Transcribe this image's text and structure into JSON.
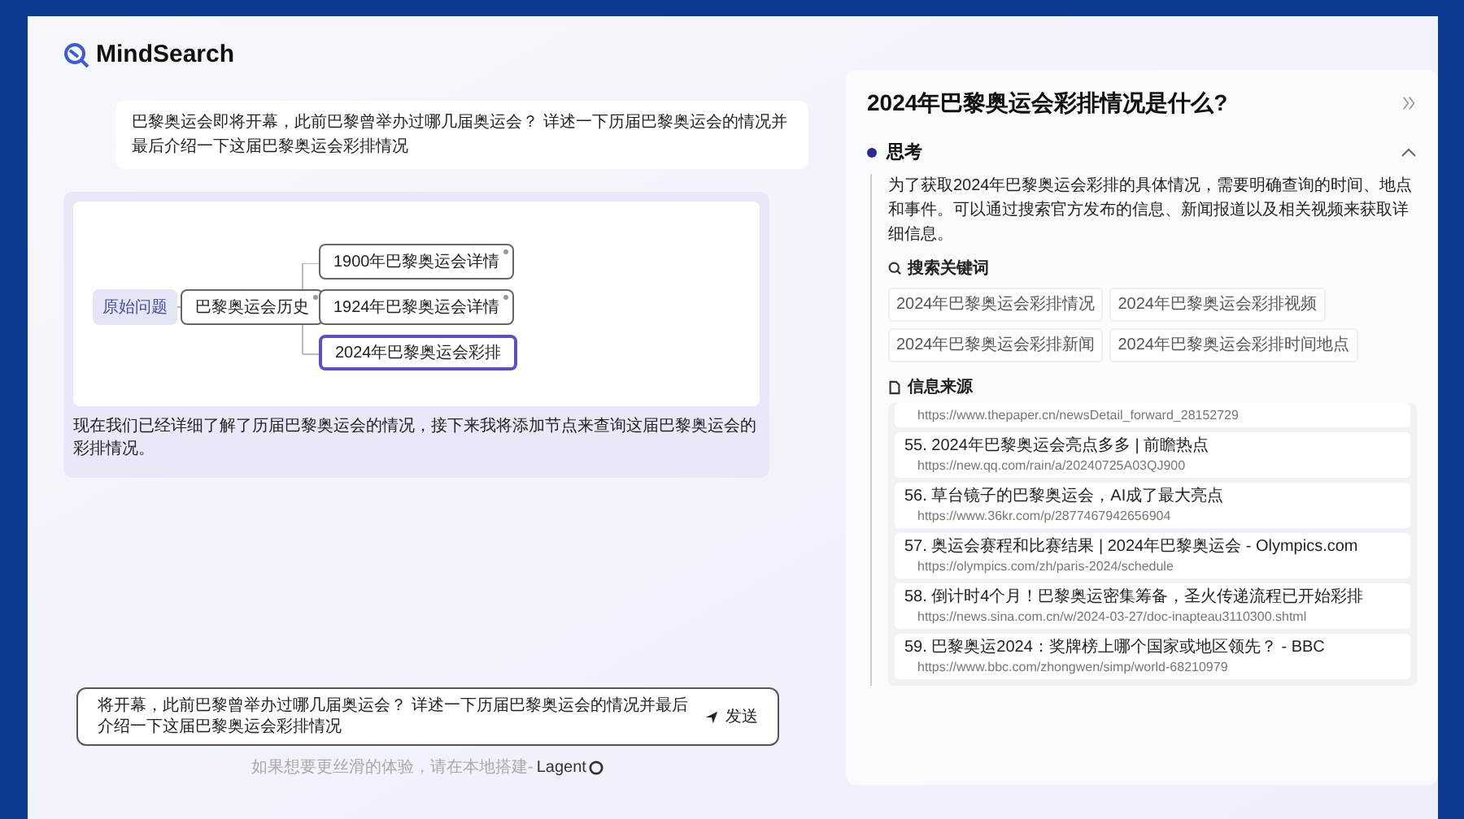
{
  "app": {
    "name": "MindSearch"
  },
  "question": "巴黎奥运会即将开幕，此前巴黎曾举办过哪几届奥运会？ 详述一下历届巴黎奥运会的情况并最后介绍一下这届巴黎奥运会彩排情况",
  "mindmap": {
    "root": "原始问题",
    "branch": "巴黎奥运会历史",
    "children": [
      {
        "label": "1900年巴黎奥运会详情",
        "selected": false,
        "starred": true
      },
      {
        "label": "1924年巴黎奥运会详情",
        "selected": false,
        "starred": true
      },
      {
        "label": "2024年巴黎奥运会彩排",
        "selected": true,
        "starred": false
      }
    ],
    "branch_starred": true
  },
  "status_text": "现在我们已经详细了解了历届巴黎奥运会的情况，接下来我将添加节点来查询这届巴黎奥运会的彩排情况。",
  "input": {
    "value": "将开幕，此前巴黎曾举办过哪几届奥运会？ 详述一下历届巴黎奥运会的情况并最后介绍一下这届巴黎奥运会彩排情况",
    "send": "发送"
  },
  "footer": {
    "text": "如果想要更丝滑的体验，请在本地搭建-",
    "link": "Lagent"
  },
  "panel": {
    "title": "2024年巴黎奥运会彩排情况是什么?",
    "section": {
      "title": "思考",
      "expanded": true
    },
    "thought": "为了获取2024年巴黎奥运会彩排的具体情况，需要明确查询的时间、地点和事件。可以通过搜索官方发布的信息、新闻报道以及相关视频来获取详细信息。",
    "keywords_title": "搜索关键词",
    "keywords": [
      "2024年巴黎奥运会彩排情况",
      "2024年巴黎奥运会彩排视频",
      "2024年巴黎奥运会彩排新闻",
      "2024年巴黎奥运会彩排时间地点"
    ],
    "sources_title": "信息来源",
    "sources": [
      {
        "url": "https://www.thepaper.cn/newsDetail_forward_28152729"
      },
      {
        "title": "55. 2024年巴黎奥运会亮点多多 | 前瞻热点",
        "url": "https://new.qq.com/rain/a/20240725A03QJ900"
      },
      {
        "title": "56. 草台镜子的巴黎奥运会，AI成了最大亮点",
        "url": "https://www.36kr.com/p/2877467942656904"
      },
      {
        "title": "57. 奥运会赛程和比赛结果 | 2024年巴黎奥运会 - Olympics.com",
        "url": "https://olympics.com/zh/paris-2024/schedule"
      },
      {
        "title": "58. 倒计时4个月！巴黎奥运密集筹备，圣火传递流程已开始彩排",
        "url": "https://news.sina.com.cn/w/2024-03-27/doc-inapteau3110300.shtml"
      },
      {
        "title": "59. 巴黎奥运2024：奖牌榜上哪个国家或地区领先？ - BBC",
        "url": "https://www.bbc.com/zhongwen/simp/world-68210979"
      }
    ]
  }
}
